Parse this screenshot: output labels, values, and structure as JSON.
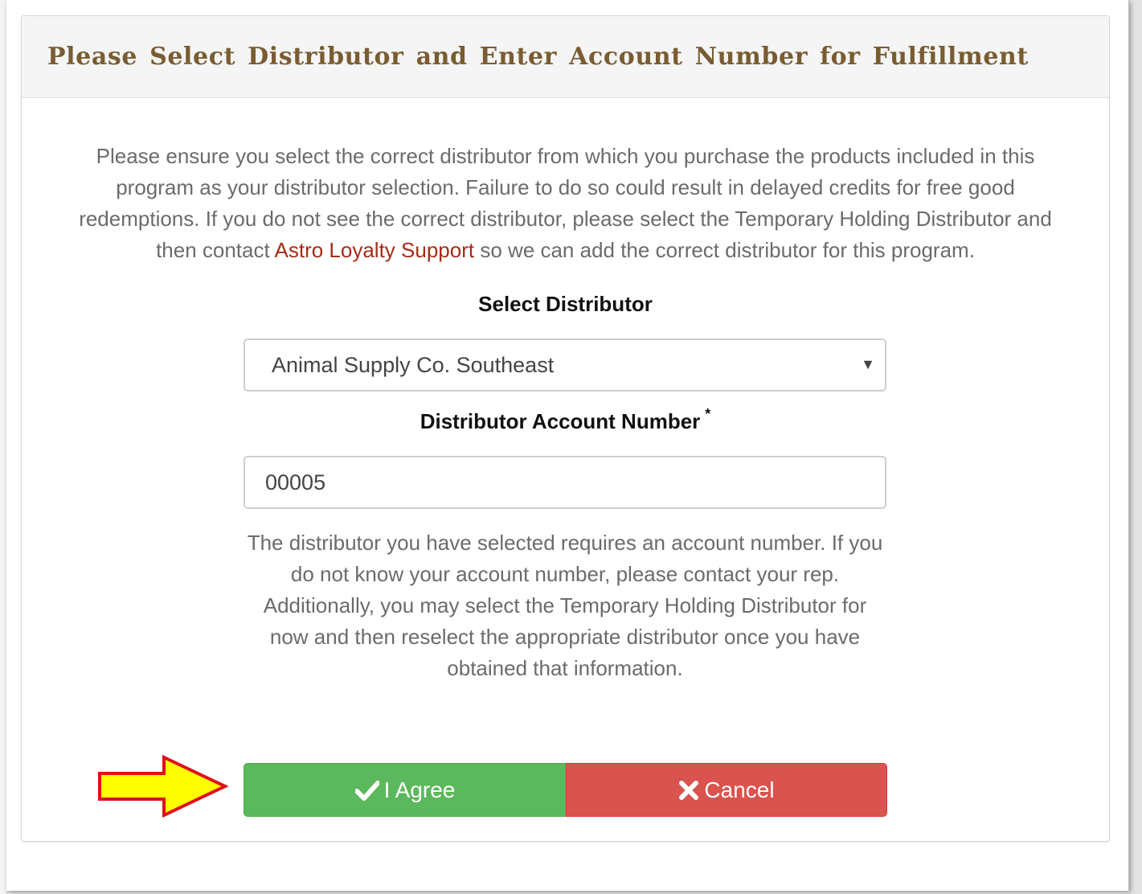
{
  "dialog": {
    "title": "Please Select Distributor and Enter Account Number for Fulfillment"
  },
  "intro": {
    "text_before_link": "Please ensure you select the correct distributor from which you purchase the products included in this program as your distributor selection. Failure to do so could result in delayed credits for free good redemptions. If you do not see the correct distributor, please select the Temporary Holding Distributor and then contact ",
    "link_text": "Astro Loyalty Support",
    "text_after_link": " so we can add the correct distributor for this program."
  },
  "distributor": {
    "label": "Select Distributor",
    "selected": "Animal Supply Co. Southeast",
    "caret": "▼"
  },
  "account": {
    "label": "Distributor Account Number",
    "required_mark": "*",
    "value": "00005"
  },
  "help_text": "The distributor you have selected requires an account number. If you do not know your account number, please contact your rep. Additionally, you may select the Temporary Holding Distributor for now and then reselect the appropriate distributor once you have obtained that information.",
  "buttons": {
    "agree_label": "I Agree",
    "agree_icon": "check-icon",
    "cancel_label": "Cancel",
    "cancel_icon": "close-icon"
  },
  "colors": {
    "title": "#7a5c32",
    "link": "#a62b17",
    "agree": "#5cb85c",
    "cancel": "#d9534f",
    "arrow_fill": "#ffff00",
    "arrow_stroke": "#e0101a"
  }
}
